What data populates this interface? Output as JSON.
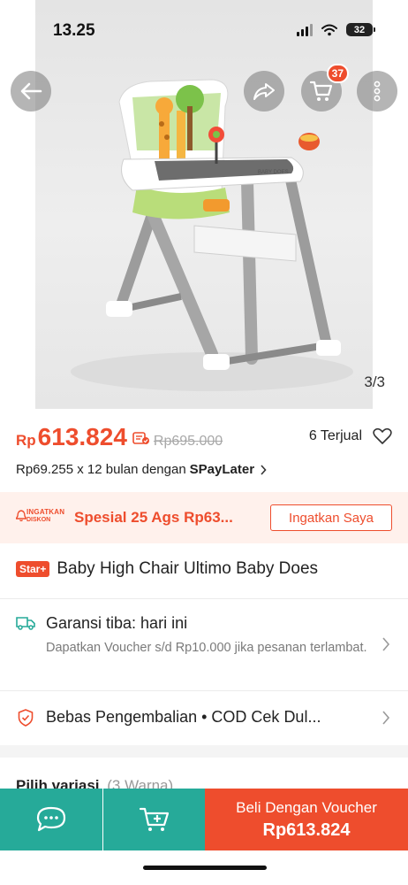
{
  "status_bar": {
    "time": "13.25",
    "battery": "32"
  },
  "header": {
    "cart_count": "37"
  },
  "gallery": {
    "counter": "3/3",
    "product_brand": "BABY DOES"
  },
  "price": {
    "currency": "Rp",
    "amount": "613.824",
    "original": "Rp695.000",
    "sold": "6 Terjual"
  },
  "paylater": {
    "text": "Rp69.255 x 12 bulan dengan",
    "brand": "SPayLater"
  },
  "flash_reminder": {
    "logo_line1": "INGATKAN",
    "logo_line2": "DISKON",
    "text": "Spesial 25 Ags Rp63...",
    "button": "Ingatkan Saya"
  },
  "product": {
    "badge": "Star+",
    "title": "Baby High Chair Ultimo Baby Does"
  },
  "shipping": {
    "title": "Garansi tiba: hari ini",
    "description": "Dapatkan Voucher s/d Rp10.000 jika pesanan terlambat."
  },
  "returns": {
    "text": "Bebas Pengembalian  •  COD Cek Dul..."
  },
  "variants": {
    "label": "Pilih variasi",
    "count": "(3 Warna)"
  },
  "bottom_bar": {
    "buy_label": "Beli Dengan Voucher",
    "buy_price": "Rp613.824"
  },
  "colors": {
    "brand": "#ee4d2d",
    "chat_green": "#26aa99",
    "reminder_bg": "#fff1ec"
  }
}
